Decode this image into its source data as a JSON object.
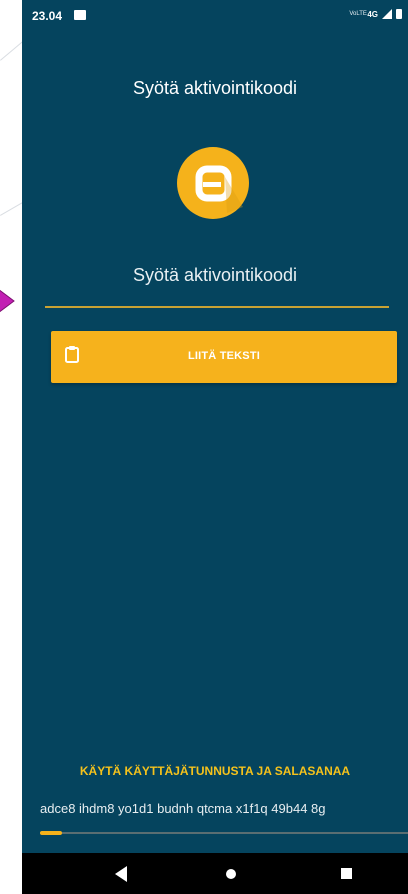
{
  "status_bar": {
    "time": "23.04",
    "volte": "VoLTE",
    "network": "4G"
  },
  "header": {
    "title": "Syötä aktivointikoodi"
  },
  "logo": {
    "icon": "app-logo-a-icon",
    "color": "#f5b21b"
  },
  "code_field": {
    "label": "Syötä aktivointikoodi"
  },
  "paste_button": {
    "label": "LIITÄ TEKSTI",
    "icon": "clipboard-icon",
    "color": "#f6b21c"
  },
  "alternate_login": {
    "label": "KÄYTÄ KÄYTTÄJÄTUNNUSTA JA SALASANAA"
  },
  "code_text": "adce8 ihdm8 yo1d1 budnh qtcma x1f1q 49b44 8g",
  "colors": {
    "background": "#05445e",
    "accent": "#f5b21b",
    "marker": "#c21fb3"
  }
}
